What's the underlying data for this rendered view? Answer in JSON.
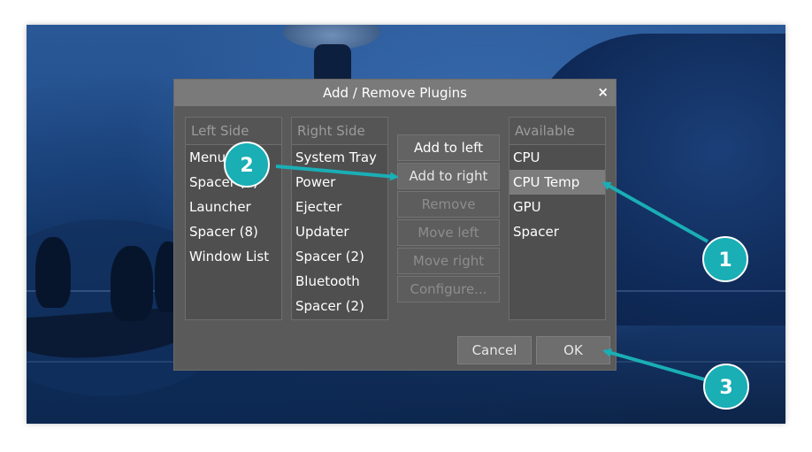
{
  "dialog": {
    "title": "Add / Remove Plugins",
    "close_glyph": "×",
    "left_side": {
      "header": "Left Side",
      "items": [
        "Menu",
        "Spacer (4)",
        "Launcher",
        "Spacer (8)",
        "Window List"
      ]
    },
    "right_side": {
      "header": "Right Side",
      "items": [
        "System Tray",
        "Power",
        "Ejecter",
        "Updater",
        "Spacer (2)",
        "Bluetooth",
        "Spacer (2)"
      ]
    },
    "available": {
      "header": "Available",
      "items": [
        "CPU",
        "CPU Temp",
        "GPU",
        "Spacer"
      ],
      "selected": "CPU Temp"
    },
    "buttons": {
      "add_left": "Add to left",
      "add_right": "Add to right",
      "remove": "Remove",
      "move_left": "Move left",
      "move_right": "Move right",
      "configure": "Configure..."
    },
    "cancel": "Cancel",
    "ok": "OK"
  },
  "annotations": {
    "color": "#1aaeb5",
    "badges": [
      "1",
      "2",
      "3"
    ]
  }
}
